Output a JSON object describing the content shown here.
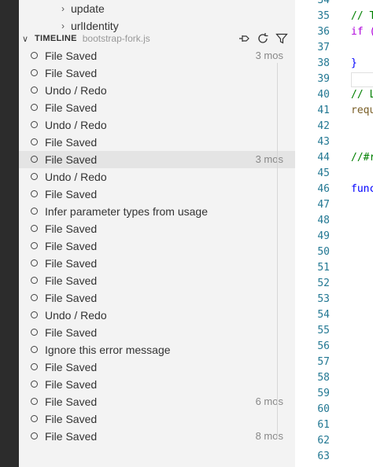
{
  "explorer": {
    "items": [
      {
        "label": "update"
      },
      {
        "label": "urlIdentity"
      }
    ]
  },
  "timeline": {
    "title": "TIMELINE",
    "file": "bootstrap-fork.js",
    "actions": {
      "pin": "pin-icon",
      "refresh": "refresh-icon",
      "filter": "filter-icon"
    },
    "items": [
      {
        "label": "File Saved",
        "time": "3 mos"
      },
      {
        "label": "File Saved",
        "time": ""
      },
      {
        "label": "Undo / Redo",
        "time": ""
      },
      {
        "label": "File Saved",
        "time": ""
      },
      {
        "label": "Undo / Redo",
        "time": ""
      },
      {
        "label": "File Saved",
        "time": ""
      },
      {
        "label": "File Saved",
        "time": "3 mos"
      },
      {
        "label": "Undo / Redo",
        "time": ""
      },
      {
        "label": "File Saved",
        "time": ""
      },
      {
        "label": "Infer parameter types from usage",
        "time": ""
      },
      {
        "label": "File Saved",
        "time": ""
      },
      {
        "label": "File Saved",
        "time": ""
      },
      {
        "label": "File Saved",
        "time": ""
      },
      {
        "label": "File Saved",
        "time": ""
      },
      {
        "label": "File Saved",
        "time": ""
      },
      {
        "label": "Undo / Redo",
        "time": ""
      },
      {
        "label": "File Saved",
        "time": ""
      },
      {
        "label": "Ignore this error message",
        "time": ""
      },
      {
        "label": "File Saved",
        "time": ""
      },
      {
        "label": "File Saved",
        "time": ""
      },
      {
        "label": "File Saved",
        "time": "6 mos"
      },
      {
        "label": "File Saved",
        "time": ""
      },
      {
        "label": "File Saved",
        "time": "8 mos"
      }
    ]
  },
  "editor": {
    "lines": [
      {
        "num": "34",
        "code": "",
        "kind": ""
      },
      {
        "num": "35",
        "code": "// T",
        "kind": "comment"
      },
      {
        "num": "36",
        "code": "if (",
        "kind": "keyword"
      },
      {
        "num": "37",
        "code": "",
        "kind": ""
      },
      {
        "num": "38",
        "code": "}",
        "kind": "punct"
      },
      {
        "num": "39",
        "code": "",
        "kind": ""
      },
      {
        "num": "40",
        "code": "// L",
        "kind": "comment"
      },
      {
        "num": "41",
        "code": "requ",
        "kind": "ident"
      },
      {
        "num": "42",
        "code": "",
        "kind": ""
      },
      {
        "num": "43",
        "code": "",
        "kind": ""
      },
      {
        "num": "44",
        "code": "//#r",
        "kind": "comment"
      },
      {
        "num": "45",
        "code": "",
        "kind": ""
      },
      {
        "num": "46",
        "code": "func",
        "kind": "func"
      },
      {
        "num": "47",
        "code": "",
        "kind": ""
      },
      {
        "num": "48",
        "code": "",
        "kind": ""
      },
      {
        "num": "49",
        "code": "",
        "kind": ""
      },
      {
        "num": "50",
        "code": "",
        "kind": ""
      },
      {
        "num": "51",
        "code": "",
        "kind": ""
      },
      {
        "num": "52",
        "code": "",
        "kind": ""
      },
      {
        "num": "53",
        "code": "",
        "kind": ""
      },
      {
        "num": "54",
        "code": "",
        "kind": ""
      },
      {
        "num": "55",
        "code": "",
        "kind": ""
      },
      {
        "num": "56",
        "code": "",
        "kind": ""
      },
      {
        "num": "57",
        "code": "",
        "kind": ""
      },
      {
        "num": "58",
        "code": "",
        "kind": ""
      },
      {
        "num": "59",
        "code": "",
        "kind": ""
      },
      {
        "num": "60",
        "code": "",
        "kind": ""
      },
      {
        "num": "61",
        "code": "",
        "kind": ""
      },
      {
        "num": "62",
        "code": "",
        "kind": ""
      },
      {
        "num": "63",
        "code": "",
        "kind": ""
      }
    ]
  }
}
